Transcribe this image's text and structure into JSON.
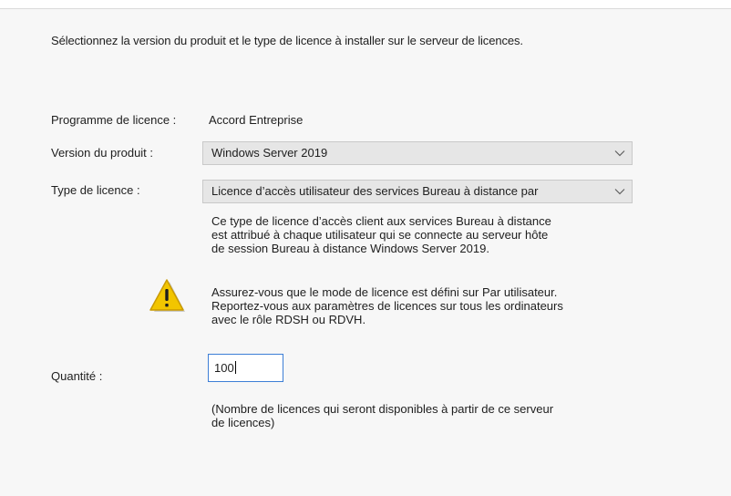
{
  "intro_text": "Sélectionnez la version du produit et le type de licence à installer sur le serveur de licences.",
  "program": {
    "label": "Programme de licence :",
    "value": "Accord Entreprise"
  },
  "product_version": {
    "label": "Version du produit :",
    "selected": "Windows Server 2019"
  },
  "license_type": {
    "label": "Type de licence :",
    "selected": "Licence d’accès utilisateur des services Bureau à distance par",
    "description": [
      "Ce type de licence d’accès client aux services Bureau à distance",
      "est attribué à chaque utilisateur qui se connecte au serveur hôte",
      "de session Bureau à distance Windows Server 2019."
    ]
  },
  "warning": {
    "icon": "warning-icon",
    "lines": [
      "Assurez-vous que le mode de licence est défini sur Par utilisateur.",
      "Reportez-vous aux paramètres de licences sur tous les ordinateurs",
      "avec le rôle RDSH ou RDVH."
    ]
  },
  "quantity": {
    "label": "Quantité :",
    "value": "100",
    "hint": [
      "(Nombre de licences qui seront disponibles à partir de ce serveur",
      "de licences)"
    ]
  },
  "colors": {
    "focus_border": "#3d7ed6",
    "warning_yellow": "#f2c500"
  }
}
